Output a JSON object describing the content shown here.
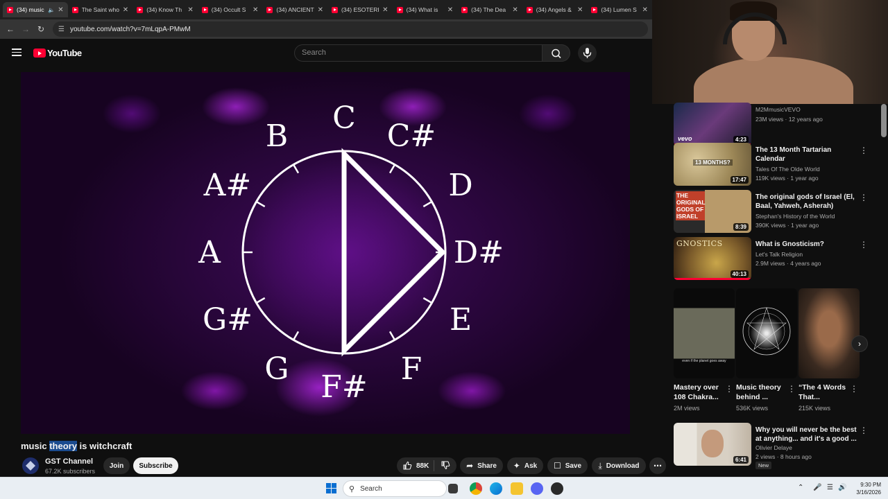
{
  "browser": {
    "tabs": [
      {
        "title": "(34) music",
        "active": true,
        "audio": true
      },
      {
        "title": "The Saint who",
        "active": false
      },
      {
        "title": "(34) Know Th",
        "active": false
      },
      {
        "title": "(34) Occult S",
        "active": false
      },
      {
        "title": "(34) ANCIENT",
        "active": false
      },
      {
        "title": "(34) ESOTERI",
        "active": false
      },
      {
        "title": "(34) What is",
        "active": false
      },
      {
        "title": "(34) The Dea",
        "active": false
      },
      {
        "title": "(34) Angels &",
        "active": false
      },
      {
        "title": "(34) Lumen S",
        "active": false
      }
    ],
    "url": "youtube.com/watch?v=7mLqpA-PMwM"
  },
  "masthead": {
    "logo_text": "YouTube",
    "search_placeholder": "Search"
  },
  "video": {
    "note_labels": [
      "C",
      "C#",
      "D",
      "D#",
      "E",
      "F",
      "F#",
      "G",
      "G#",
      "A",
      "A#",
      "B"
    ],
    "title_before": "music ",
    "title_highlight": "theory",
    "title_after": " is witchcraft",
    "channel_name": "GST Channel",
    "subscribers": "67.2K subscribers",
    "join_label": "Join",
    "subscribe_label": "Subscribe",
    "likes": "88K",
    "share_label": "Share",
    "ask_label": "Ask",
    "save_label": "Save",
    "download_label": "Download"
  },
  "sidebar": {
    "recommendations": [
      {
        "title": "",
        "channel": "M2MmusicVEVO",
        "meta": "23M views · 12 years ago",
        "duration": "4:23",
        "thumb_text": "vevo"
      },
      {
        "title": "The 13 Month Tartarian Calendar",
        "channel": "Tales Of The Olde World",
        "meta": "119K views · 1 year ago",
        "duration": "17:47",
        "thumb_text": "13 MONTHS?"
      },
      {
        "title": "The original gods of Israel (El, Baal, Yahweh, Asherah)",
        "channel": "Stephan's History of the World",
        "meta": "390K views · 1 year ago",
        "duration": "8:39",
        "thumb_text": "THE ORIGINAL GODS OF ISRAEL"
      },
      {
        "title": "What is Gnosticism?",
        "channel": "Let's Talk Religion",
        "meta": "2.9M views · 4 years ago",
        "duration": "40:13",
        "thumb_text": "GNOSTICS"
      },
      {
        "title": "Why you will never be the best at anything... and it's a good ...",
        "channel": "Olivier Delaye",
        "meta": "2 views · 8 hours ago",
        "duration": "6:41",
        "badge": "New"
      }
    ],
    "shorts": [
      {
        "title": "Mastery over 108 Chakra...",
        "views": "2M views",
        "caption": "even if the planet goes away"
      },
      {
        "title": "Music theory behind ...",
        "views": "536K views"
      },
      {
        "title": "“The 4 Words That...",
        "views": "215K views"
      }
    ]
  },
  "taskbar": {
    "search_label": "Search",
    "time": "9:30 PM",
    "date": "3/16/2026"
  },
  "colors": {
    "youtube_red": "#ff0033",
    "background": "#0f0f0f",
    "video_purple": "#8a1fc0"
  }
}
